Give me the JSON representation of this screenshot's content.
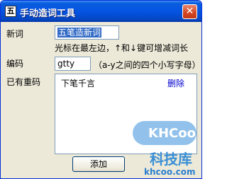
{
  "window": {
    "title": "手动造词工具",
    "app_icon_glyph": "五",
    "close_glyph": "✕"
  },
  "new_word": {
    "label": "新词",
    "value": "五笔造新词",
    "hint": "光标在最左边，↑和↓键可增减词长"
  },
  "code": {
    "label": "编码",
    "value": "gtty",
    "hint": "（a-y之间的四个小写字母）"
  },
  "existing": {
    "label": "已有重码",
    "items": [
      {
        "word": "下笔千言",
        "action": "删除"
      }
    ]
  },
  "buttons": {
    "add": "添加"
  },
  "watermark": {
    "logo": "KHCoo",
    "name": "科技库",
    "url": "khcoo.com"
  },
  "colors": {
    "titlebar": "#0554e3",
    "dialog_bg": "#ece9d8",
    "selection": "#316ac5",
    "link": "#0000cc",
    "close": "#d24320"
  }
}
